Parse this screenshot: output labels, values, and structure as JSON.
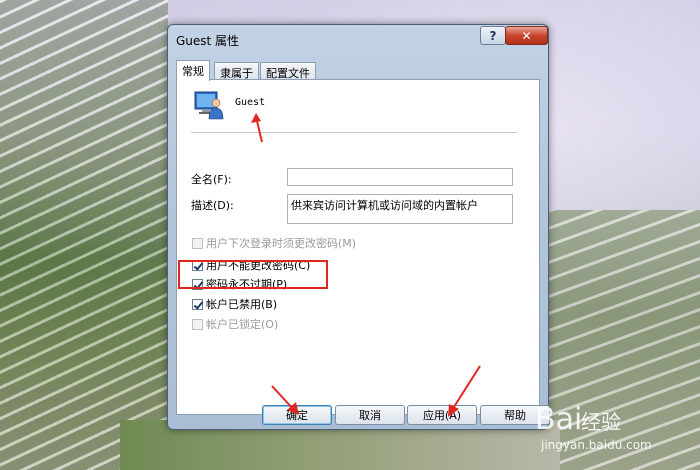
{
  "window": {
    "title": "Guest 属性",
    "help_glyph": "?",
    "close_glyph": "✕"
  },
  "tabs": [
    {
      "label": "常规",
      "active": true
    },
    {
      "label": "隶属于",
      "active": false
    },
    {
      "label": "配置文件",
      "active": false
    }
  ],
  "user": {
    "name": "Guest"
  },
  "fields": {
    "fullname_label": "全名(F):",
    "fullname_value": "",
    "description_label": "描述(D):",
    "description_value": "供来宾访问计算机或访问域的内置帐户"
  },
  "checkboxes": [
    {
      "label": "用户下次登录时须更改密码(M)",
      "checked": false,
      "enabled": false
    },
    {
      "label": "用户不能更改密码(C)",
      "checked": true,
      "enabled": true
    },
    {
      "label": "密码永不过期(P)",
      "checked": true,
      "enabled": true
    },
    {
      "label": "帐户已禁用(B)",
      "checked": true,
      "enabled": true
    },
    {
      "label": "帐户已锁定(O)",
      "checked": false,
      "enabled": false
    }
  ],
  "buttons": {
    "ok": "确定",
    "cancel": "取消",
    "apply": "应用(A)",
    "help": "帮助"
  },
  "watermark": {
    "brand": "经验",
    "paw": "Bai",
    "url": "jingyan.baidu.com"
  },
  "colors": {
    "annotation_red": "#e0271e"
  }
}
